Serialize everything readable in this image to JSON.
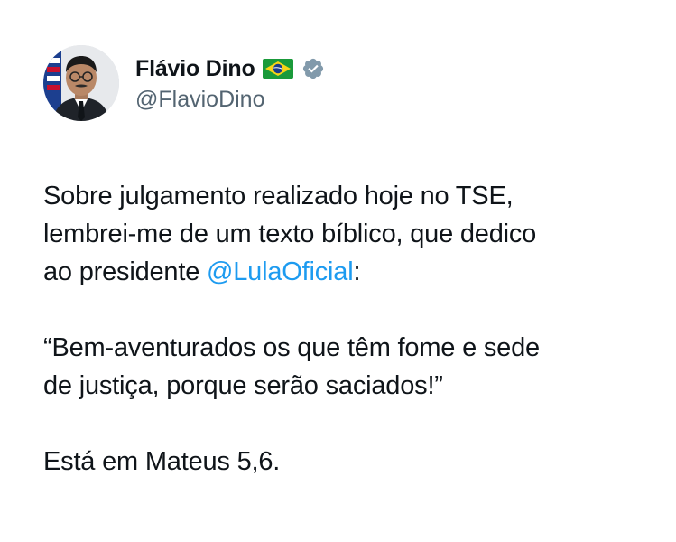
{
  "author": {
    "display_name": "Flávio Dino",
    "handle": "@FlavioDino",
    "avatar_icon": "profile-photo",
    "flag_icon": "brazil-flag-icon",
    "verified_icon": "verified-badge-icon",
    "verified_color": "#829aab"
  },
  "tweet": {
    "para1_before": "Sobre julgamento realizado hoje no TSE,\nlembrei-me de um texto bíblico, que dedico\nao presidente ",
    "mention": "@LulaOficial",
    "para1_after": ":",
    "para2": "“Bem-aventurados os que têm fome e sede\nde justiça, porque serão saciados!”",
    "para3": "Está em Mateus 5,6."
  },
  "colors": {
    "text": "#0f1419",
    "secondary": "#536471",
    "mention": "#1d9bf0",
    "background": "#ffffff"
  }
}
